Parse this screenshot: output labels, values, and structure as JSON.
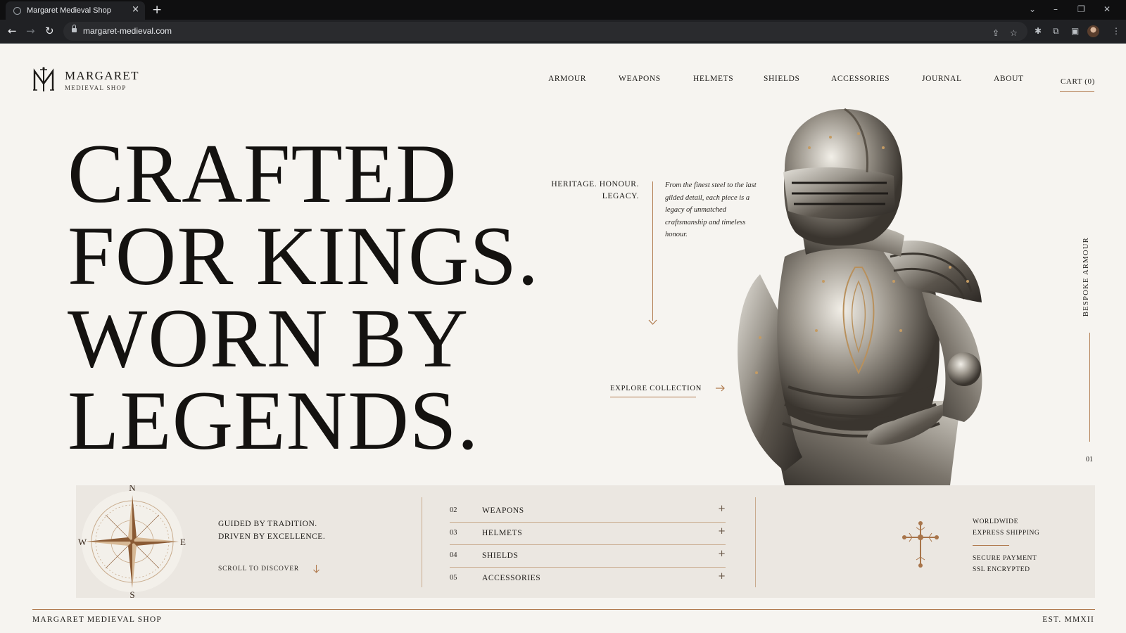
{
  "browser": {
    "tab_title": "Margaret Medieval Shop",
    "url": "margaret-medieval.com",
    "icons": [
      "back-icon",
      "forward-icon",
      "reload-icon",
      "lock-icon",
      "share-icon",
      "bookmark-star-icon",
      "extensions-icon",
      "puzzle-icon",
      "sidebar-icon",
      "profile-avatar",
      "menu-dots-icon"
    ]
  },
  "brand": {
    "name": "MARGARET",
    "subtitle": "MEDIEVAL SHOP",
    "logo_letters": "M"
  },
  "nav": {
    "items": [
      "ARMOUR",
      "WEAPONS",
      "HELMETS",
      "SHIELDS",
      "ACCESSORIES",
      "JOURNAL",
      "ABOUT"
    ],
    "cart_label": "CART (0)"
  },
  "hero": {
    "headline_lines": [
      "CRAFTED",
      "FOR KINGS.",
      "WORN BY",
      "LEGENDS."
    ],
    "tagline_lines": [
      "HERITAGE. HONOUR.",
      "LEGACY."
    ],
    "blurb": "From the finest steel to the last gilded detail, each piece is a legacy of unmatched craftsmanship and timeless honour.",
    "cta_label": "EXPLORE COLLECTION",
    "side_label": "BESPOKE ARMOUR",
    "side_number": "01"
  },
  "strip": {
    "compass_letters": {
      "n": "N",
      "s": "S",
      "e": "E",
      "w": "W"
    },
    "guide_lines": [
      "GUIDED BY TRADITION.",
      "DRIVEN BY EXCELLENCE."
    ],
    "scroll_label": "SCROLL TO DISCOVER",
    "categories": [
      {
        "num": "02",
        "name": "WEAPONS"
      },
      {
        "num": "03",
        "name": "HELMETS"
      },
      {
        "num": "04",
        "name": "SHIELDS"
      },
      {
        "num": "05",
        "name": "ACCESSORIES"
      }
    ],
    "expand_symbol": "+",
    "shipping_lines": [
      "WORLDWIDE",
      "EXPRESS SHIPPING"
    ],
    "payment_lines": [
      "SECURE PAYMENT",
      "SSL ENCRYPTED"
    ]
  },
  "footer": {
    "left": "MARGARET MEDIEVAL SHOP",
    "right": "EST. MMXII"
  },
  "colors": {
    "background": "#f6f4f0",
    "strip": "#ebe7e1",
    "accent": "#b07a4e",
    "text": "#1c1a17"
  }
}
